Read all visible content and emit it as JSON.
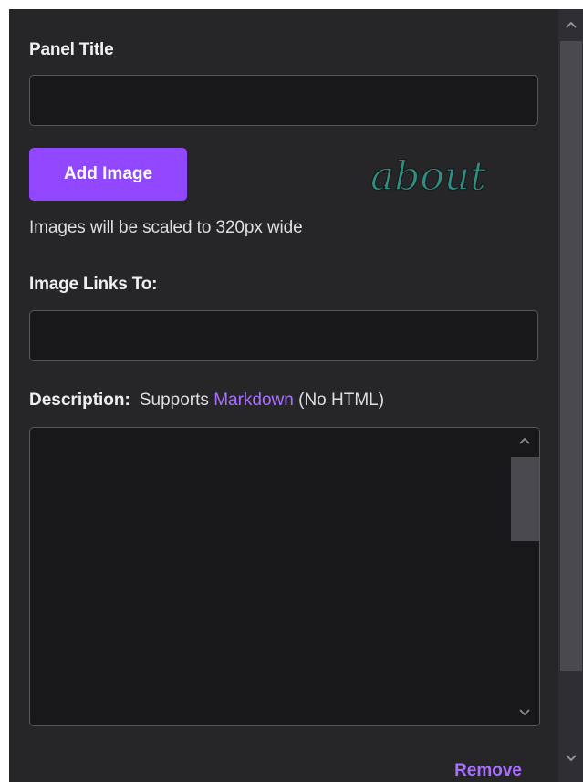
{
  "panel": {
    "title_label": "Panel Title",
    "title_value": "",
    "add_image_label": "Add Image",
    "preview_logo_text": "about",
    "preview_logo_color": "#2f8f86",
    "image_hint": "Images will be scaled to 320px wide",
    "link_label": "Image Links To:",
    "link_value": "",
    "description_label": "Description:",
    "supports_text": "Supports ",
    "markdown_link_text": "Markdown",
    "no_html_text": " (No HTML)",
    "description_value": "",
    "remove_label": "Remove"
  },
  "colors": {
    "panel_bg": "#262629",
    "input_bg": "#18181b",
    "accent": "#9147ff",
    "link": "#a970ff"
  },
  "icons": {
    "scroll_up": "chevron-up-icon",
    "scroll_down": "chevron-down-icon"
  }
}
